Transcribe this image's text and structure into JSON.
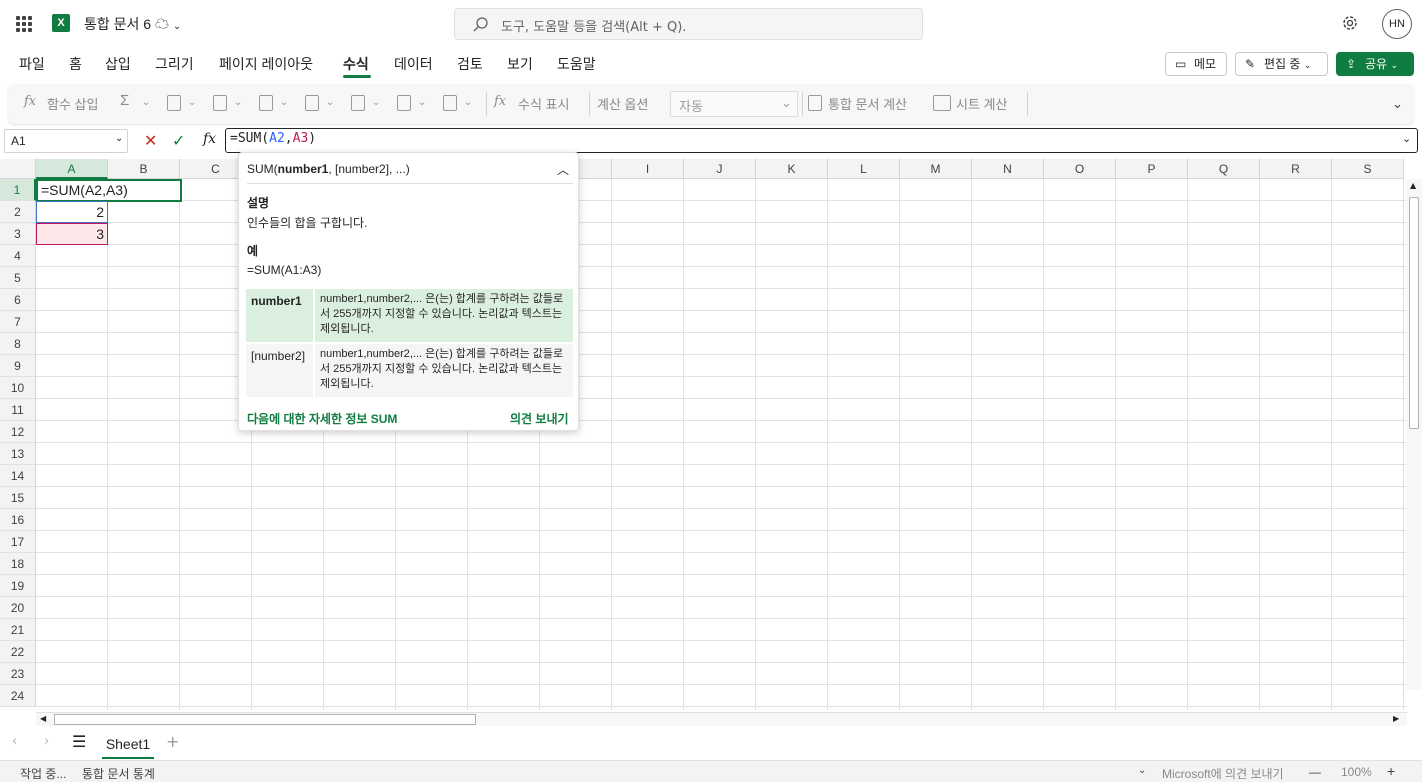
{
  "app": {
    "title": "통합 문서 6",
    "logo_letter": "X",
    "avatar": "HN"
  },
  "search": {
    "placeholder": "도구, 도움말 등을 검색(Alt + Q)."
  },
  "tabs": [
    "파일",
    "홈",
    "삽입",
    "그리기",
    "페이지 레이아웃",
    "수식",
    "데이터",
    "검토",
    "보기",
    "도움말"
  ],
  "active_tab": "수식",
  "actions": {
    "memo": "메모",
    "editing": "편집 중",
    "share": "공유"
  },
  "ribbon": {
    "insert_function": "함수 삽입",
    "show_formulas": "수식 표시",
    "calc_options": "계산 옵션",
    "calc_mode": "자동",
    "calc_workbook": "통합 문서 계산",
    "calc_sheet": "시트 계산"
  },
  "formula_bar": {
    "name_box": "A1",
    "prefix": "=SUM(",
    "arg1": "A2",
    "comma": ",",
    "arg2": "A3",
    "suffix": ")",
    "fx": "fx"
  },
  "columns": [
    "A",
    "B",
    "C",
    "D",
    "E",
    "F",
    "G",
    "H",
    "I",
    "J",
    "K",
    "L",
    "M",
    "N",
    "O",
    "P",
    "Q",
    "R",
    "S"
  ],
  "rows": [
    "1",
    "2",
    "3",
    "4",
    "5",
    "6",
    "7",
    "8",
    "9",
    "10",
    "11",
    "12",
    "13",
    "14",
    "15",
    "16",
    "17",
    "18",
    "19",
    "20",
    "21",
    "22",
    "23",
    "24"
  ],
  "cells": {
    "A1": "=SUM(A2,A3)",
    "A2": "2",
    "A3": "3"
  },
  "tooltip": {
    "func": "SUM(",
    "arg_current": "number1",
    "args_rest": ", [number2], ...)",
    "desc_heading": "설명",
    "desc": "인수들의 합을 구합니다.",
    "example_heading": "예",
    "example": "=SUM(A1:A3)",
    "params": [
      {
        "name": "number1",
        "desc": "number1,number2,... 은(는) 합계를 구하려는 값들로서 255개까지 지정할 수 있습니다. 논리값과 텍스트는 제외됩니다."
      },
      {
        "name": "[number2]",
        "desc": "number1,number2,... 은(는) 합계를 구하려는 값들로서 255개까지 지정할 수 있습니다. 논리값과 텍스트는 제외됩니다."
      }
    ],
    "more_info": "다음에 대한 자세한 정보 SUM",
    "feedback": "의견 보내기"
  },
  "sheets": {
    "active": "Sheet1"
  },
  "status": {
    "working": "작업 중...",
    "stats": "통합 문서 통계",
    "feedback": "Microsoft에 의견 보내기",
    "zoom": "100%"
  },
  "colors": {
    "accent": "#107c41",
    "ref1": "#2962ff",
    "ref2": "#c2185b"
  }
}
